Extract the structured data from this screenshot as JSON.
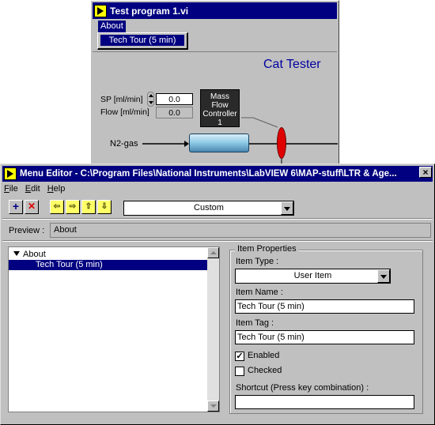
{
  "back_window": {
    "title": "Test program 1.vi",
    "menu_about": "About",
    "dropdown_item": "Tech Tour (5 min)",
    "panel_title": "Cat Tester",
    "sp_label": "SP [ml/min]",
    "sp_value": "0.0",
    "flow_label": "Flow [ml/min]",
    "flow_value": "0.0",
    "mfc_label": [
      "Mass",
      "Flow",
      "Controller",
      "1"
    ],
    "gas_label": "N2-gas"
  },
  "editor": {
    "title": "Menu Editor - C:\\Program Files\\National Instruments\\LabVIEW 6\\MAP-stuff\\LTR & Age...",
    "close_glyph": "×",
    "menus": [
      {
        "mnemonic": "F",
        "rest": "ile"
      },
      {
        "mnemonic": "E",
        "rest": "dit"
      },
      {
        "mnemonic": "H",
        "rest": "elp"
      }
    ],
    "toolbar": {
      "add_glyph": "+",
      "delete_glyph": "✕",
      "left_glyph": "⇦",
      "right_glyph": "⇨",
      "up_glyph": "⇧",
      "down_glyph": "⇩"
    },
    "menu_type": "Custom",
    "preview_label": "Preview :",
    "preview_value": "About",
    "tree": [
      {
        "label": "About",
        "level": 0,
        "expanded": true,
        "selected": false
      },
      {
        "label": "Tech Tour (5 min)",
        "level": 1,
        "selected": true
      }
    ],
    "props": {
      "group_label": "Item Properties",
      "type_label": "Item Type :",
      "type_value": "User Item",
      "name_label": "Item Name :",
      "name_value": "Tech Tour (5 min)",
      "tag_label": "Item Tag :",
      "tag_value": "Tech Tour (5 min)",
      "enabled_label": "Enabled",
      "enabled_checked": true,
      "checked_label": "Checked",
      "checked_checked": false,
      "shortcut_label": "Shortcut (Press key  combination) :",
      "shortcut_value": ""
    }
  },
  "colors": {
    "titlebar": "#000080",
    "window": "#c0c0c0",
    "panel_title": "#0000a0",
    "valve": "#e00000"
  }
}
